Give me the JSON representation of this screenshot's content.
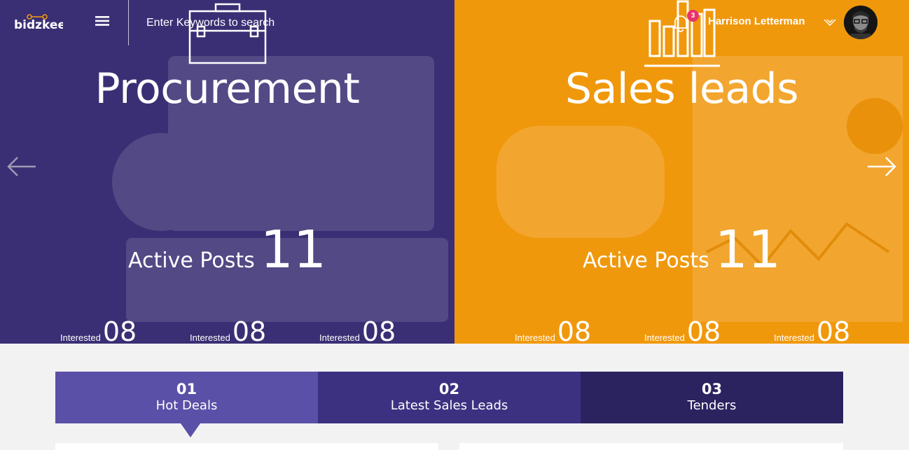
{
  "brand": {
    "logo_text": "bidzkee"
  },
  "search": {
    "placeholder": "Enter Keywords to search"
  },
  "user": {
    "name": "Harrison Letterman",
    "notifications": "3"
  },
  "colors": {
    "procurement": "#3a2f74",
    "sales": "#f0980c",
    "tab1": "#5b50a7",
    "tab2": "#3c3181",
    "tab3": "#2b2260",
    "badge": "#e8336a"
  },
  "panels": [
    {
      "title": "Procurement",
      "icon": "briefcase-icon",
      "active_label": "Active Posts",
      "active_count": "11",
      "stats": [
        {
          "label": "Interested",
          "value": "08"
        },
        {
          "label": "Interested",
          "value": "08"
        },
        {
          "label": "Interested",
          "value": "08"
        }
      ]
    },
    {
      "title": "Sales leads",
      "icon": "bar-chart-icon",
      "active_label": "Active Posts",
      "active_count": "11",
      "stats": [
        {
          "label": "Interested",
          "value": "08"
        },
        {
          "label": "Interested",
          "value": "08"
        },
        {
          "label": "Interested",
          "value": "08"
        }
      ]
    }
  ],
  "tabs": [
    {
      "number": "01",
      "label": "Hot Deals",
      "active": true
    },
    {
      "number": "02",
      "label": "Latest Sales Leads",
      "active": false
    },
    {
      "number": "03",
      "label": "Tenders",
      "active": false
    }
  ]
}
